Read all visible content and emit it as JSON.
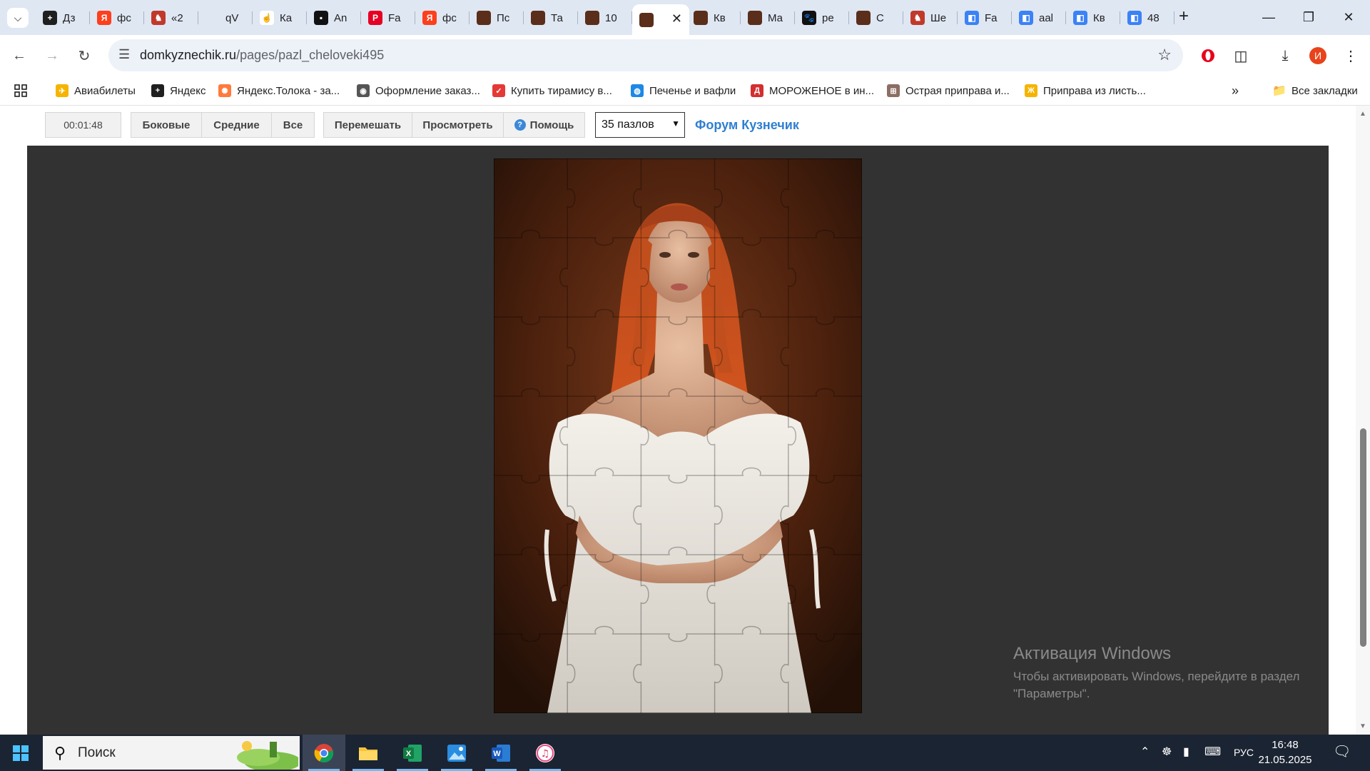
{
  "browser": {
    "tabs": [
      {
        "label": "Дз",
        "color": "#1f1f1f",
        "glyph": "+"
      },
      {
        "label": "фс",
        "color": "#fc3f1d",
        "glyph": "Я"
      },
      {
        "label": "«2",
        "color": "#c0392b",
        "glyph": "♞"
      },
      {
        "label": "qV",
        "color": "#dfe7f3",
        "glyph": ""
      },
      {
        "label": "Ка",
        "color": "#ffffff",
        "glyph": "☝"
      },
      {
        "label": "An",
        "color": "#111111",
        "glyph": "▪"
      },
      {
        "label": "Fa",
        "color": "#e60023",
        "glyph": "P"
      },
      {
        "label": "фс",
        "color": "#fc3f1d",
        "glyph": "Я"
      },
      {
        "label": "Пс",
        "color": "#5a2e1a",
        "glyph": ""
      },
      {
        "label": "Та",
        "color": "#5a2e1a",
        "glyph": ""
      },
      {
        "label": "10",
        "color": "#5a2e1a",
        "glyph": ""
      },
      {
        "label": "",
        "color": "#5a2e1a",
        "glyph": ""
      },
      {
        "label": "Кв",
        "color": "#5a2e1a",
        "glyph": ""
      },
      {
        "label": "Ма",
        "color": "#5a2e1a",
        "glyph": ""
      },
      {
        "label": "ре",
        "color": "#111111",
        "glyph": "🐾"
      },
      {
        "label": "С",
        "color": "#5a2e1a",
        "glyph": ""
      },
      {
        "label": "Ше",
        "color": "#c0392b",
        "glyph": "♞"
      },
      {
        "label": "Fa",
        "color": "#3b82f6",
        "glyph": "◧"
      },
      {
        "label": "aal",
        "color": "#3b82f6",
        "glyph": "◧"
      },
      {
        "label": "Кв",
        "color": "#3b82f6",
        "glyph": "◧"
      },
      {
        "label": "48",
        "color": "#3b82f6",
        "glyph": "◧"
      }
    ],
    "active_tab_index": 11,
    "new_tab": "+",
    "url_host": "domkyznechik.ru",
    "url_path": "/pages/pazl_cheloveki495",
    "profile_initial": "И",
    "bookmarks": [
      {
        "label": "Авиабилеты",
        "color": "#f5b400",
        "glyph": "✈"
      },
      {
        "label": "Яндекс",
        "color": "#1f1f1f",
        "glyph": "+"
      },
      {
        "label": "Яндекс.Толока - за...",
        "color": "#ff7a3d",
        "glyph": "✺"
      },
      {
        "label": "Оформление заказ...",
        "color": "#555555",
        "glyph": "◉"
      },
      {
        "label": "Купить тирамису в...",
        "color": "#e53935",
        "glyph": "✓"
      },
      {
        "label": "Печенье и вафли",
        "color": "#1e88e5",
        "glyph": "◍"
      },
      {
        "label": "МОРОЖЕНОЕ в ин...",
        "color": "#d32f2f",
        "glyph": "Д"
      },
      {
        "label": "Острая приправа и...",
        "color": "#8d6e63",
        "glyph": "⊞"
      },
      {
        "label": "Приправа из листь...",
        "color": "#f5b400",
        "glyph": "Ж"
      }
    ],
    "more_bookmarks": "»",
    "all_bookmarks": "Все закладки"
  },
  "puzzle_page": {
    "timer": "00:01:48",
    "filters": [
      "Боковые",
      "Средние",
      "Все"
    ],
    "actions": [
      "Перемешать",
      "Просмотреть",
      "Помощь"
    ],
    "pieces_select": "35 пазлов",
    "forum_link": "Форум Кузнечик",
    "grid": {
      "cols": 5,
      "rows": 7
    }
  },
  "watermark": {
    "title": "Активация Windows",
    "line1": "Чтобы активировать Windows, перейдите в раздел",
    "line2": "\"Параметры\"."
  },
  "taskbar": {
    "search_placeholder": "Поиск",
    "apps": [
      "chrome",
      "file-explorer",
      "excel",
      "photos",
      "word",
      "itunes"
    ],
    "language": "РУС",
    "time": "16:48",
    "date": "21.05.2025"
  },
  "colors": {
    "tabstrip": "#dfe7f3",
    "stage": "#323232",
    "forum_link": "#2f7fd1",
    "taskbar": "#1b2433"
  }
}
